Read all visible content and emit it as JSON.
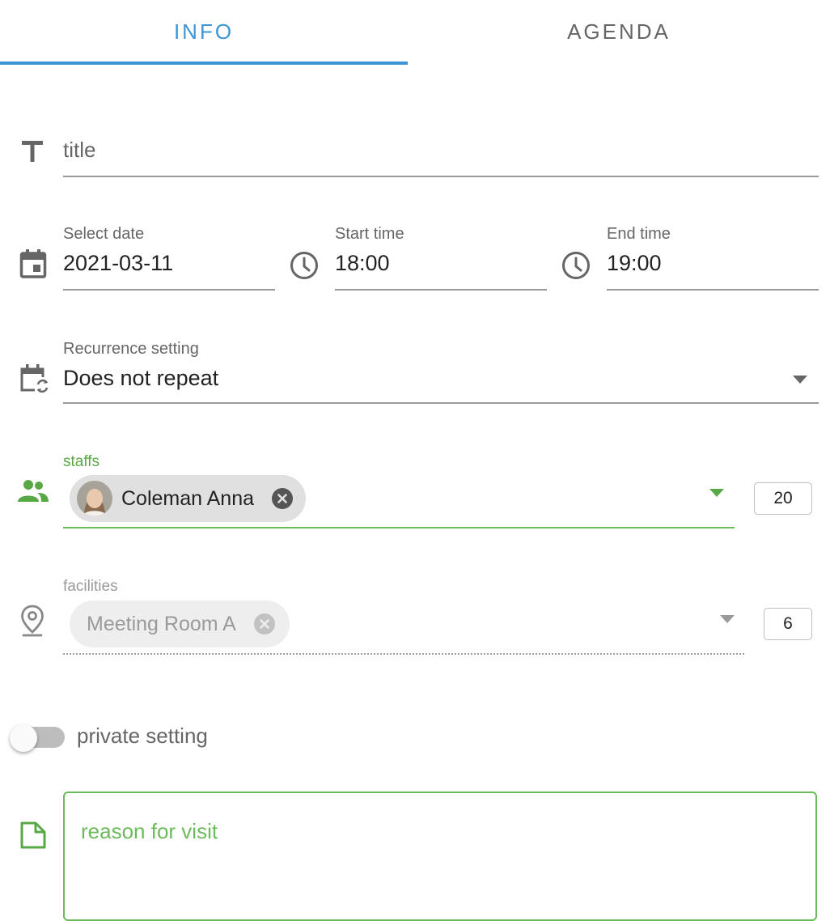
{
  "tabs": [
    {
      "label": "INFO",
      "active": true
    },
    {
      "label": "AGENDA",
      "active": false
    }
  ],
  "title_field": {
    "placeholder": "title",
    "value": ""
  },
  "date_field": {
    "label": "Select date",
    "value": "2021-03-11"
  },
  "start_time_field": {
    "label": "Start time",
    "value": "18:00"
  },
  "end_time_field": {
    "label": "End time",
    "value": "19:00"
  },
  "recurrence": {
    "label": "Recurrence setting",
    "value": "Does not repeat"
  },
  "staffs": {
    "label": "staffs",
    "chips": [
      {
        "name": "Coleman Anna"
      }
    ],
    "count": "20"
  },
  "facilities": {
    "label": "facilities",
    "chips": [
      {
        "name": "Meeting Room A"
      }
    ],
    "count": "6"
  },
  "private_setting": {
    "label": "private setting",
    "enabled": false
  },
  "reason": {
    "placeholder": "reason for visit"
  },
  "colors": {
    "accent_blue": "#3d96d3",
    "accent_green": "#6cbb5a",
    "underline_gray": "#9a9a9a"
  }
}
